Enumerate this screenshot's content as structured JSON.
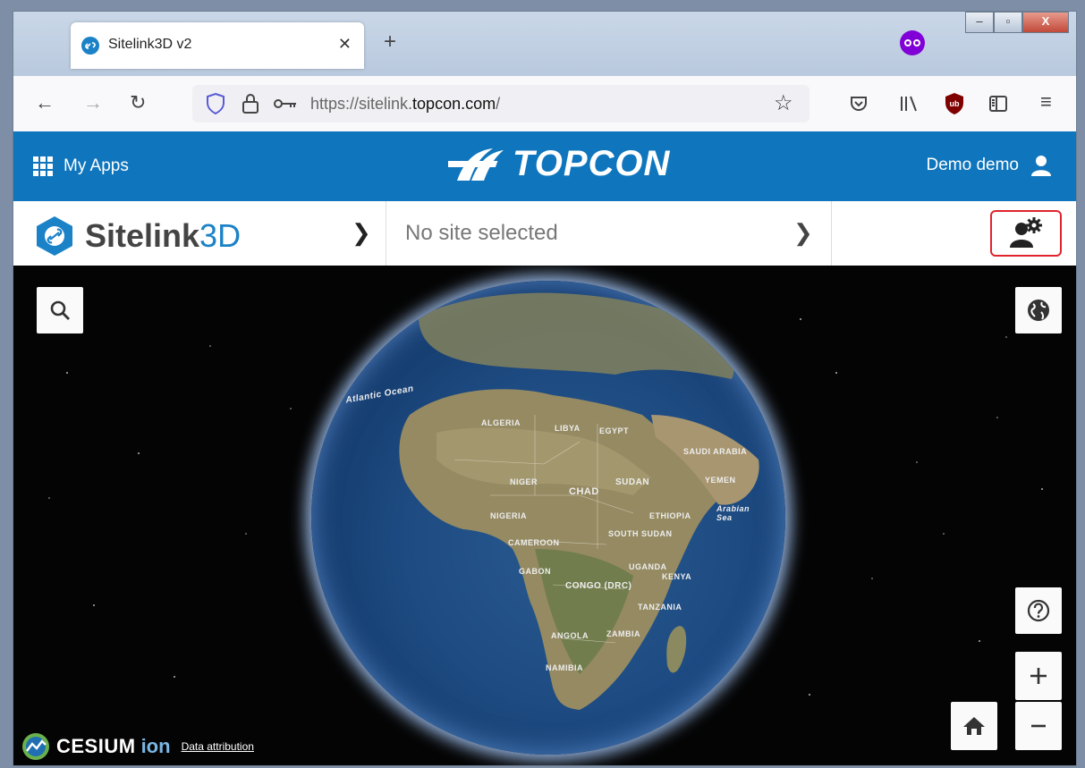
{
  "browser": {
    "tab_title": "Sitelink3D v2",
    "url_prefix": "https://sitelink.",
    "url_domain": "topcon.com",
    "url_suffix": "/"
  },
  "topbar": {
    "my_apps": "My Apps",
    "brand": "TOPCON",
    "user_name": "Demo demo"
  },
  "sitebar": {
    "app_name_bold": "Sitelink",
    "app_name_thin": "3D",
    "site_selector": "No site selected"
  },
  "map": {
    "labels": [
      "Atlantic Ocean",
      "LIBYA",
      "EGYPT",
      "ALGERIA",
      "NIGER",
      "CHAD",
      "SUDAN",
      "NIGERIA",
      "ETHIOPIA",
      "SOUTH SUDAN",
      "CAMEROON",
      "GABON",
      "CONGO (DRC)",
      "UGANDA",
      "KENYA",
      "TANZANIA",
      "ANGOLA",
      "ZAMBIA",
      "NAMIBIA",
      "Arabian Sea",
      "SAUDI ARABIA",
      "YEMEN"
    ],
    "cesium_brand": "CESIUM",
    "cesium_ion": "ion",
    "attribution": "Data attribution"
  },
  "colors": {
    "topcon_blue": "#0f75bd",
    "highlight_red": "#e0242c",
    "sitelink_blue": "#1b82c7"
  }
}
